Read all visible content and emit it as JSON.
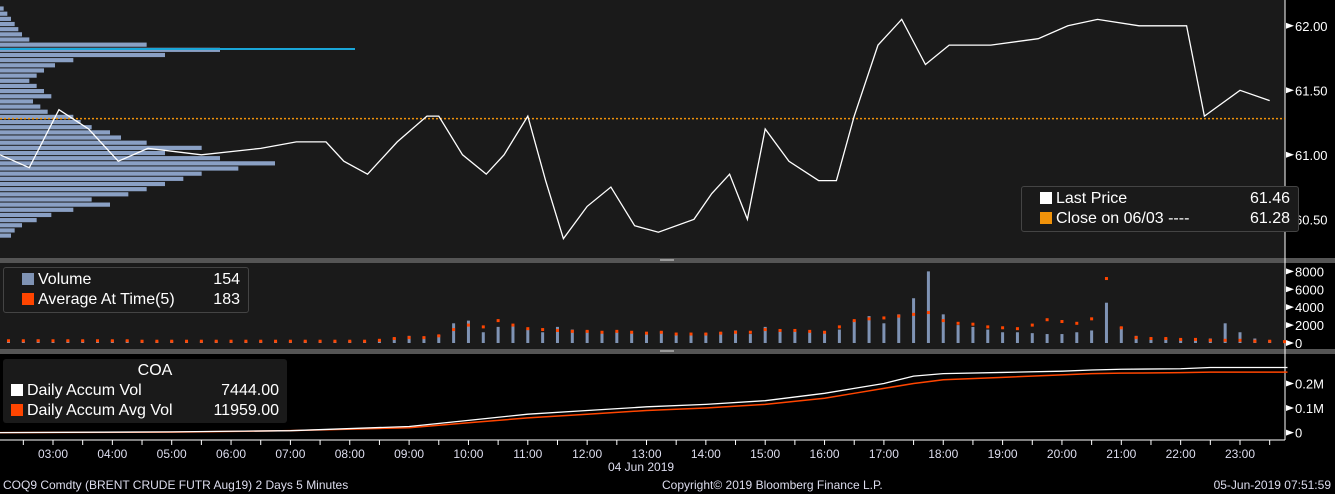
{
  "colors": {
    "price": "#ffffff",
    "close": "#f0920a",
    "profile": "#8aa0c4",
    "profile_hi": "#1aa6d8",
    "volume": "#7f93b4",
    "avg": "#ff4500",
    "accum": "#ffffff",
    "accum_avg": "#ff4500",
    "bg": "#1a1a1a"
  },
  "price_legend": {
    "last_label": "Last Price",
    "last_value": "61.46",
    "close_label": "Close on 06/03",
    "close_dashes": "----",
    "close_value": "61.28"
  },
  "volume_legend": {
    "volume_label": "Volume",
    "volume_value": "154",
    "avg_label": "Average At Time(5)",
    "avg_value": "183"
  },
  "accum_legend": {
    "title": "COA",
    "vol_label": "Daily Accum Vol",
    "vol_value": "7444.00",
    "avg_label": "Daily Accum Avg Vol",
    "avg_value": "11959.00"
  },
  "footer": {
    "security": "COQ9 Comdty (BRENT CRUDE FUTR  Aug19) 2 Days 5 Minutes",
    "copyright": "Copyright© 2019 Bloomberg Finance L.P.",
    "timestamp": "05-Jun-2019 07:51:59",
    "date_label": "04 Jun 2019"
  },
  "chart_data": [
    {
      "type": "line",
      "title": "Last Price",
      "ylim": [
        60.2,
        62.2
      ],
      "yticks": [
        "62.00",
        "61.50",
        "61.00",
        "60.50"
      ],
      "ytick_values": [
        62,
        61.5,
        61,
        60.5
      ],
      "close_ref": 61.28,
      "x_hours": [
        2.1,
        2.6,
        3.1,
        3.6,
        4.1,
        4.6,
        5.5,
        6.5,
        7.1,
        7.6,
        7.9,
        8.3,
        8.8,
        9.3,
        9.5,
        9.9,
        10.3,
        10.6,
        11.0,
        11.3,
        11.6,
        12.0,
        12.4,
        12.8,
        13.2,
        13.8,
        14.1,
        14.4,
        14.7,
        15.0,
        15.4,
        15.9,
        16.2,
        16.5,
        16.9,
        17.3,
        17.7,
        18.1,
        18.8,
        19.6,
        20.1,
        20.6,
        21.3,
        22.1,
        22.4,
        23.0,
        23.5
      ],
      "price": [
        61.0,
        60.9,
        61.35,
        61.2,
        60.95,
        61.05,
        61.0,
        61.05,
        61.1,
        61.1,
        60.95,
        60.85,
        61.1,
        61.3,
        61.3,
        61.0,
        60.85,
        61.0,
        61.3,
        60.8,
        60.35,
        60.6,
        60.75,
        60.45,
        60.4,
        60.5,
        60.7,
        60.85,
        60.5,
        61.2,
        60.95,
        60.8,
        60.8,
        61.3,
        61.85,
        62.05,
        61.7,
        61.85,
        61.85,
        61.9,
        62.0,
        62.05,
        62.0,
        62.0,
        61.3,
        61.5,
        61.42
      ],
      "profile_prices_top": 62.15,
      "profile_step": 0.04,
      "profile_volume": [
        1,
        2,
        3,
        4,
        5,
        6,
        8,
        40,
        60,
        45,
        20,
        15,
        12,
        10,
        8,
        10,
        12,
        14,
        9,
        11,
        13,
        20,
        22,
        25,
        30,
        33,
        40,
        55,
        45,
        60,
        75,
        65,
        55,
        50,
        45,
        40,
        35,
        25,
        30,
        20,
        14,
        10,
        6,
        4,
        3
      ]
    },
    {
      "type": "bar",
      "title": "Volume",
      "ylim": [
        0,
        8600
      ],
      "yticks": [
        "8000",
        "6000",
        "4000",
        "2000",
        "0"
      ],
      "ytick_values": [
        8000,
        6000,
        4000,
        2000,
        0
      ],
      "x_start_hour": 2.25,
      "interval_hours": 0.25,
      "volume": [
        300,
        250,
        400,
        350,
        300,
        300,
        250,
        300,
        300,
        250,
        200,
        250,
        200,
        200,
        250,
        200,
        200,
        250,
        200,
        200,
        250,
        200,
        200,
        250,
        200,
        300,
        600,
        800,
        700,
        900,
        2200,
        2500,
        1200,
        1800,
        2000,
        1500,
        1200,
        1800,
        1500,
        1400,
        1300,
        1200,
        1100,
        1000,
        1300,
        900,
        1000,
        1100,
        1200,
        1400,
        1000,
        1800,
        1500,
        1300,
        1200,
        1300,
        1500,
        2500,
        3000,
        2200,
        3200,
        5000,
        8000,
        3200,
        2000,
        1800,
        1500,
        1200,
        1200,
        1100,
        1000,
        1000,
        1200,
        1400,
        4500,
        1800,
        800,
        600,
        500,
        400,
        500,
        500,
        2200,
        1200,
        500,
        300,
        200
      ],
      "average": [
        250,
        250,
        250,
        250,
        250,
        250,
        250,
        250,
        250,
        200,
        200,
        200,
        200,
        200,
        200,
        200,
        200,
        200,
        200,
        200,
        200,
        200,
        200,
        200,
        200,
        300,
        500,
        600,
        600,
        800,
        1500,
        2000,
        1800,
        2500,
        2000,
        1600,
        1500,
        1400,
        1300,
        1300,
        1200,
        1300,
        1200,
        1100,
        1200,
        1000,
        1000,
        1000,
        1100,
        1200,
        1200,
        1500,
        1400,
        1400,
        1300,
        1200,
        1800,
        2500,
        2700,
        2800,
        3000,
        3200,
        3400,
        2500,
        2200,
        2100,
        1800,
        1700,
        1600,
        2000,
        2600,
        2400,
        2200,
        2700,
        7200,
        1700,
        600,
        500,
        500,
        400,
        400,
        300,
        300,
        300,
        200,
        200,
        150
      ]
    },
    {
      "type": "line",
      "title": "COA",
      "ylim": [
        -30000,
        320000
      ],
      "yticks": [
        "0.2M",
        "0.1M",
        "0"
      ],
      "ytick_values": [
        200000,
        100000,
        0
      ],
      "x_hours": [
        2.1,
        5,
        7,
        9,
        10,
        11,
        12,
        13,
        14,
        15,
        16,
        16.5,
        17,
        17.5,
        18,
        19,
        20,
        20.5,
        21,
        22,
        22.5,
        23.8
      ],
      "accum": [
        0,
        3000,
        8000,
        25000,
        50000,
        75000,
        90000,
        105000,
        115000,
        130000,
        160000,
        180000,
        200000,
        230000,
        240000,
        245000,
        250000,
        255000,
        258000,
        260000,
        265000,
        265000
      ],
      "accum_avg": [
        0,
        2000,
        8000,
        20000,
        40000,
        60000,
        75000,
        90000,
        100000,
        115000,
        140000,
        160000,
        180000,
        200000,
        215000,
        225000,
        235000,
        240000,
        242000,
        244000,
        246000,
        246000
      ]
    }
  ],
  "x_axis": {
    "ticks": [
      "03:00",
      "04:00",
      "05:00",
      "06:00",
      "07:00",
      "08:00",
      "09:00",
      "10:00",
      "11:00",
      "12:00",
      "13:00",
      "14:00",
      "15:00",
      "16:00",
      "17:00",
      "18:00",
      "19:00",
      "20:00",
      "21:00",
      "22:00",
      "23:00"
    ]
  }
}
